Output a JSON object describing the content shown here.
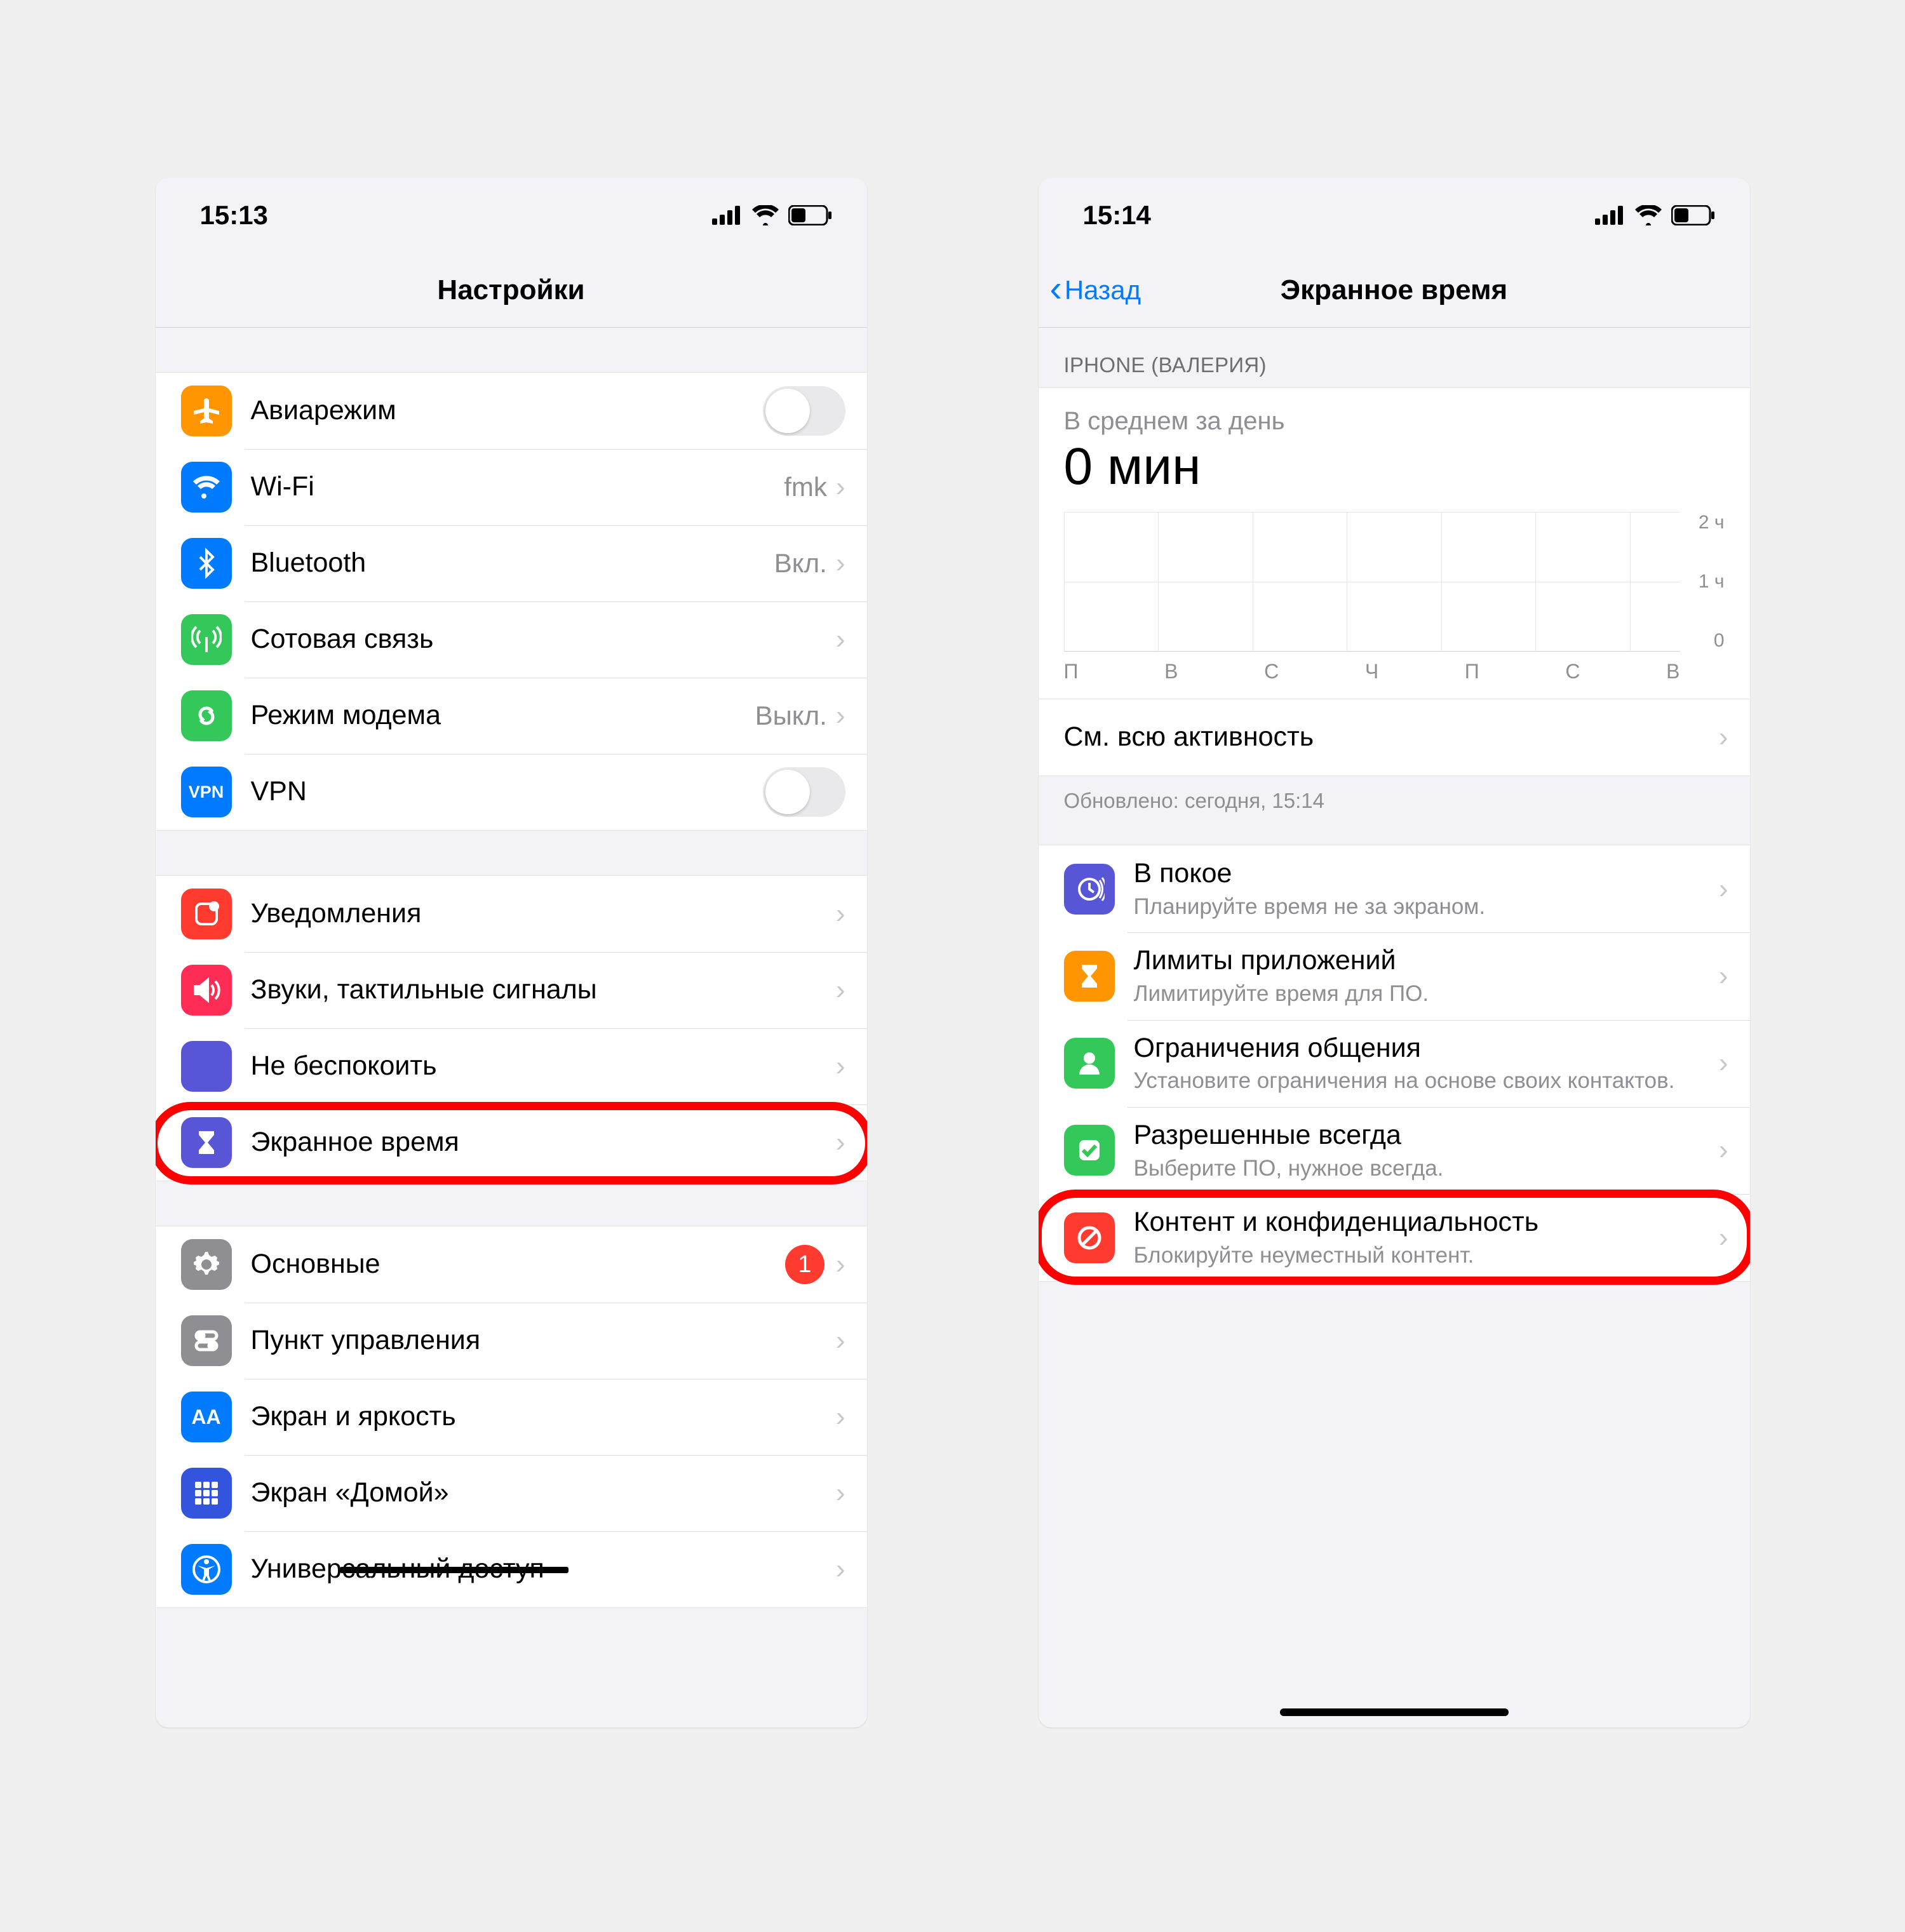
{
  "left": {
    "status": {
      "time": "15:13"
    },
    "nav": {
      "title": "Настройки"
    },
    "groups": [
      {
        "rows": [
          {
            "id": "airplane",
            "icon": "airplane-icon",
            "iconBg": "#ff9500",
            "title": "Авиарежим",
            "accessory": "toggle"
          },
          {
            "id": "wifi",
            "icon": "wifi-icon",
            "iconBg": "#007aff",
            "title": "Wi-Fi",
            "detail": "fmk",
            "accessory": "chevron"
          },
          {
            "id": "bluetooth",
            "icon": "bluetooth-icon",
            "iconBg": "#007aff",
            "title": "Bluetooth",
            "detail": "Вкл.",
            "accessory": "chevron"
          },
          {
            "id": "cellular",
            "icon": "antenna-icon",
            "iconBg": "#34c759",
            "title": "Сотовая связь",
            "accessory": "chevron"
          },
          {
            "id": "hotspot",
            "icon": "link-icon",
            "iconBg": "#34c759",
            "title": "Режим модема",
            "detail": "Выкл.",
            "accessory": "chevron"
          },
          {
            "id": "vpn",
            "icon": "vpn-icon",
            "iconBg": "#007aff",
            "iconText": "VPN",
            "title": "VPN",
            "accessory": "toggle"
          }
        ]
      },
      {
        "rows": [
          {
            "id": "notifications",
            "icon": "notification-icon",
            "iconBg": "#ff3b30",
            "title": "Уведомления",
            "accessory": "chevron"
          },
          {
            "id": "sounds",
            "icon": "speaker-icon",
            "iconBg": "#ff2d55",
            "title": "Звуки, тактильные сигналы",
            "accessory": "chevron"
          },
          {
            "id": "dnd",
            "icon": "moon-icon",
            "iconBg": "#5856d6",
            "title": "Не беспокоить",
            "accessory": "chevron"
          },
          {
            "id": "screentime",
            "icon": "hourglass-icon",
            "iconBg": "#5856d6",
            "title": "Экранное время",
            "accessory": "chevron",
            "highlighted": true
          }
        ]
      },
      {
        "rows": [
          {
            "id": "general",
            "icon": "gear-icon",
            "iconBg": "#8e8e93",
            "title": "Основные",
            "badge": "1",
            "accessory": "chevron"
          },
          {
            "id": "control-center",
            "icon": "switches-icon",
            "iconBg": "#8e8e93",
            "title": "Пункт управления",
            "accessory": "chevron"
          },
          {
            "id": "display",
            "icon": "textsize-icon",
            "iconBg": "#007aff",
            "iconText": "AA",
            "title": "Экран и яркость",
            "accessory": "chevron"
          },
          {
            "id": "homescreen",
            "icon": "grid-icon",
            "iconBg": "#3355dd",
            "title": "Экран «Домой»",
            "accessory": "chevron"
          },
          {
            "id": "accessibility",
            "icon": "accessibility-icon",
            "iconBg": "#007aff",
            "title": "Универсальный доступ",
            "accessory": "chevron"
          }
        ]
      }
    ]
  },
  "right": {
    "status": {
      "time": "15:14"
    },
    "nav": {
      "back": "Назад",
      "title": "Экранное время"
    },
    "deviceHeader": "IPHONE (ВАЛЕРИЯ)",
    "chart": {
      "avgLabel": "В среднем за день",
      "avgValue": "0 мин",
      "yTicks": [
        "2 ч",
        "1 ч",
        "0"
      ],
      "days": [
        "П",
        "В",
        "С",
        "Ч",
        "П",
        "С",
        "В"
      ]
    },
    "seeAll": "См. всю активность",
    "updated": "Обновлено: сегодня, 15:14",
    "options": [
      {
        "id": "downtime",
        "icon": "downtime-icon",
        "iconBg": "#5856d6",
        "title": "В покое",
        "sub": "Планируйте время не за экраном."
      },
      {
        "id": "applimits",
        "icon": "hourglass-icon",
        "iconBg": "#ff9500",
        "title": "Лимиты приложений",
        "sub": "Лимитируйте время для ПО."
      },
      {
        "id": "commlimits",
        "icon": "person-icon",
        "iconBg": "#34c759",
        "title": "Ограничения общения",
        "sub": "Установите ограничения на основе своих контактов."
      },
      {
        "id": "always",
        "icon": "check-icon",
        "iconBg": "#34c759",
        "title": "Разрешенные всегда",
        "sub": "Выберите ПО, нужное всегда."
      },
      {
        "id": "content",
        "icon": "nosign-icon",
        "iconBg": "#ff3b30",
        "title": "Контент и конфиденциальность",
        "sub": "Блокируйте неуместный контент.",
        "highlighted": true
      }
    ]
  },
  "chart_data": {
    "type": "bar",
    "title": "В среднем за день",
    "categories": [
      "П",
      "В",
      "С",
      "Ч",
      "П",
      "С",
      "В"
    ],
    "values": [
      0,
      0,
      0,
      0,
      0,
      0,
      0
    ],
    "ylabel": "",
    "xlabel": "",
    "ylim": [
      0,
      2
    ],
    "y_unit": "ч",
    "y_ticks": [
      0,
      1,
      2
    ],
    "average_label": "0 мин"
  }
}
